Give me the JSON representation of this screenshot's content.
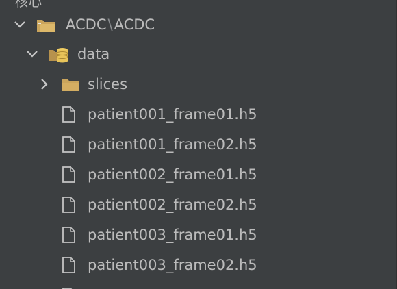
{
  "header": {
    "partial_label": "核心"
  },
  "project": {
    "root_label": "ACDC",
    "separator": "\\",
    "path_label": "ACDC",
    "data_folder": "data",
    "slices_folder": "slices"
  },
  "files": [
    "patient001_frame01.h5",
    "patient001_frame02.h5",
    "patient002_frame01.h5",
    "patient002_frame02.h5",
    "patient003_frame01.h5",
    "patient003_frame02.h5"
  ],
  "colors": {
    "background": "#3c3f41",
    "text": "#bbbbbb",
    "folder": "#c9a45c",
    "db_icon": "#e8c45a",
    "file_icon": "#c4c4c4"
  },
  "icons": {
    "chevron_expanded": "chevron-down-icon",
    "chevron_collapsed": "chevron-right-icon",
    "module_folder": "folder-icon",
    "data_folder": "database-folder-icon",
    "file": "file-icon"
  }
}
